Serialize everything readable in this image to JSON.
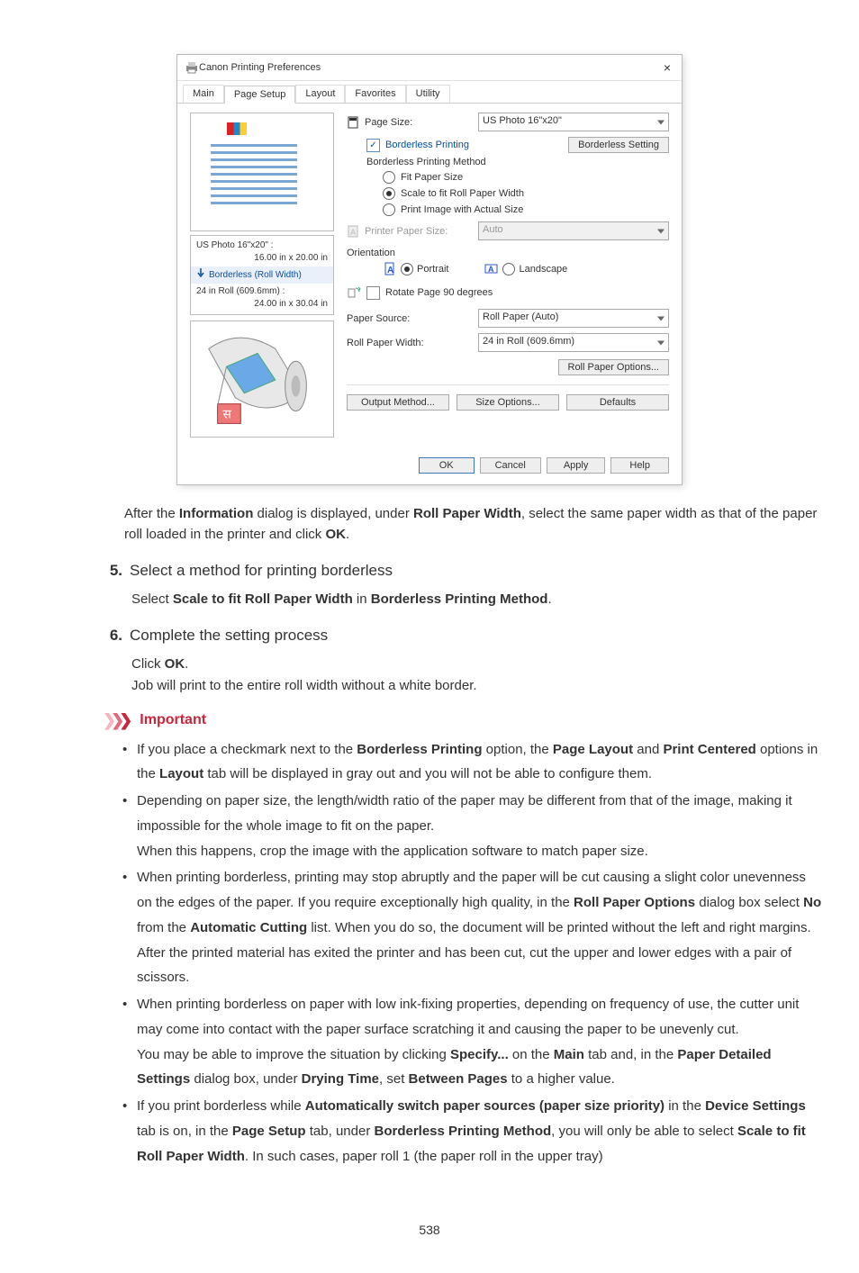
{
  "dialog": {
    "titlebar": "Canon           Printing Preferences",
    "close_glyph": "×",
    "tabs": [
      "Main",
      "Page Setup",
      "Layout",
      "Favorites",
      "Utility"
    ],
    "active_tab_index": 1,
    "page_size_label": "Page Size:",
    "page_size_value": "US Photo 16\"x20\"",
    "borderless_printing_label": "Borderless Printing",
    "borderless_setting_btn": "Borderless Setting",
    "borderless_method_label": "Borderless Printing Method",
    "fit_paper_size_label": "Fit Paper Size",
    "scale_to_fit_label": "Scale to fit Roll Paper Width",
    "print_actual_label": "Print Image with Actual Size",
    "printer_paper_size_label": "Printer Paper Size:",
    "printer_paper_size_value": "Auto",
    "orientation_label": "Orientation",
    "portrait_label": "Portrait",
    "landscape_label": "Landscape",
    "rotate_90_label": "Rotate Page 90 degrees",
    "paper_source_label": "Paper Source:",
    "paper_source_value": "Roll Paper (Auto)",
    "roll_width_label": "Roll Paper Width:",
    "roll_width_value": "24 in Roll (609.6mm)",
    "roll_options_btn": "Roll Paper Options...",
    "output_method_btn": "Output Method...",
    "size_options_btn": "Size Options...",
    "defaults_btn": "Defaults",
    "ok_btn": "OK",
    "cancel_btn": "Cancel",
    "apply_btn": "Apply",
    "help_btn": "Help",
    "left_info_line1a": "US Photo 16\"x20\" :",
    "left_info_line1b": "16.00 in x 20.00 in",
    "left_info_mid": "Borderless (Roll Width)",
    "left_info_line2a": "24 in Roll (609.6mm) :",
    "left_info_line2b": "24.00 in x 30.04 in"
  },
  "text": {
    "after_dialog_1": "After the ",
    "after_dialog_b1": "Information",
    "after_dialog_2": " dialog is displayed, under ",
    "after_dialog_b2": "Roll Paper Width",
    "after_dialog_3": ", select the same paper width as that of the paper roll loaded in the printer and click ",
    "after_dialog_b3": "OK",
    "after_dialog_4": "."
  },
  "steps": {
    "s5_num": "5.",
    "s5_title": "Select a method for printing borderless",
    "s5_body_1": "Select ",
    "s5_body_b1": "Scale to fit Roll Paper Width",
    "s5_body_2": " in ",
    "s5_body_b2": "Borderless Printing Method",
    "s5_body_3": ".",
    "s6_num": "6.",
    "s6_title": "Complete the setting process",
    "s6_line1_a": "Click ",
    "s6_line1_b": "OK",
    "s6_line1_c": ".",
    "s6_line2": "Job will print to the entire roll width without a white border."
  },
  "important_label": "Important",
  "bullets": {
    "i1_a": "If you place a checkmark next to the ",
    "i1_b1": "Borderless Printing",
    "i1_b": " option, the ",
    "i1_b2": "Page Layout",
    "i1_c": " and ",
    "i1_b3": "Print Centered",
    "i1_d": " options in the ",
    "i1_b4": "Layout",
    "i1_e": " tab will be displayed in gray out and you will not be able to configure them.",
    "i2_a": "Depending on paper size, the length/width ratio of the paper may be different from that of the image, making it impossible for the whole image to fit on the paper.",
    "i2_b": "When this happens, crop the image with the application software to match paper size.",
    "i3_a": "When printing borderless, printing may stop abruptly and the paper will be cut causing a slight color unevenness on the edges of the paper. If you require exceptionally high quality, in the ",
    "i3_b1": "Roll Paper Options",
    "i3_b": " dialog box select ",
    "i3_b2": "No",
    "i3_c": " from the ",
    "i3_b3": "Automatic Cutting",
    "i3_d": " list. When you do so, the document will be printed without the left and right margins. After the printed material has exited the printer and has been cut, cut the upper and lower edges with a pair of scissors.",
    "i4_a": "When printing borderless on paper with low ink-fixing properties, depending on frequency of use, the cutter unit may come into contact with the paper surface scratching it and causing the paper to be unevenly cut.",
    "i4_b": "You may be able to improve the situation by clicking ",
    "i4_b1": "Specify...",
    "i4_c": " on the ",
    "i4_b2": "Main",
    "i4_d": " tab and, in the ",
    "i4_b3": "Paper Detailed Settings",
    "i4_e": " dialog box, under ",
    "i4_b4": "Drying Time",
    "i4_f": ", set ",
    "i4_b5": "Between Pages",
    "i4_g": " to a higher value.",
    "i5_a": "If you print borderless while ",
    "i5_b1": "Automatically switch paper sources (paper size priority)",
    "i5_b": " in the ",
    "i5_b2": "Device Settings",
    "i5_c": " tab is on, in the ",
    "i5_b3": "Page Setup",
    "i5_d": " tab, under ",
    "i5_b4": "Borderless Printing Method",
    "i5_e": ", you will only be able to select ",
    "i5_b5": "Scale to fit Roll Paper Width",
    "i5_f": ". In such cases, paper roll 1 (the paper roll in the upper tray)"
  },
  "page_number": "538"
}
